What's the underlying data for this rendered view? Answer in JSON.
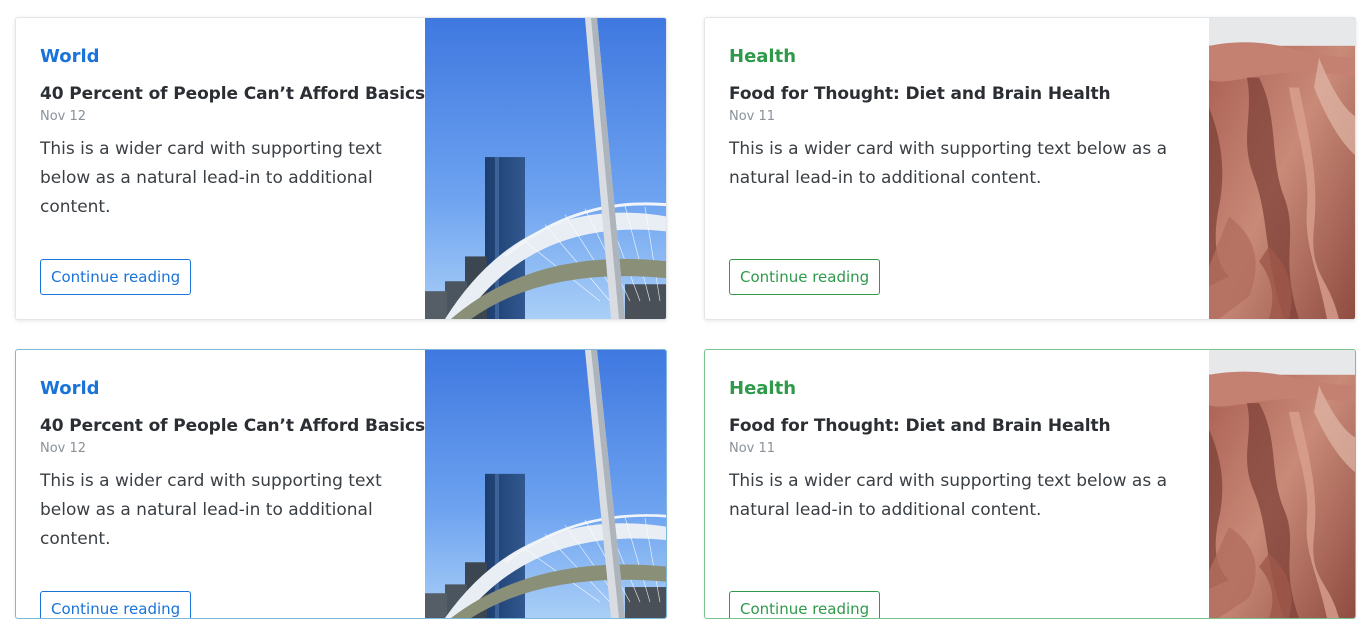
{
  "colors": {
    "world": "#1a73d9",
    "health": "#2e9a4a"
  },
  "cards": [
    {
      "category": "World",
      "title": "40 Percent of People Can’t Afford Basics",
      "date": "Nov 12",
      "text": "This is a wider card with supporting text below as a natural lead-in to additional content.",
      "button": "Continue reading",
      "image": "bridge-city-thumbnail"
    },
    {
      "category": "Health",
      "title": "Food for Thought: Diet and Brain Health",
      "date": "Nov 11",
      "text": "This is a wider card with supporting text below as a natural lead-in to additional content.",
      "button": "Continue reading",
      "image": "red-rock-thumbnail"
    },
    {
      "category": "World",
      "title": "40 Percent of People Can’t Afford Basics",
      "date": "Nov 12",
      "text": "This is a wider card with supporting text below as a natural lead-in to additional content.",
      "button": "Continue reading",
      "image": "bridge-city-thumbnail"
    },
    {
      "category": "Health",
      "title": "Food for Thought: Diet and Brain Health",
      "date": "Nov 11",
      "text": "This is a wider card with supporting text below as a natural lead-in to additional content.",
      "button": "Continue reading",
      "image": "red-rock-thumbnail"
    }
  ]
}
